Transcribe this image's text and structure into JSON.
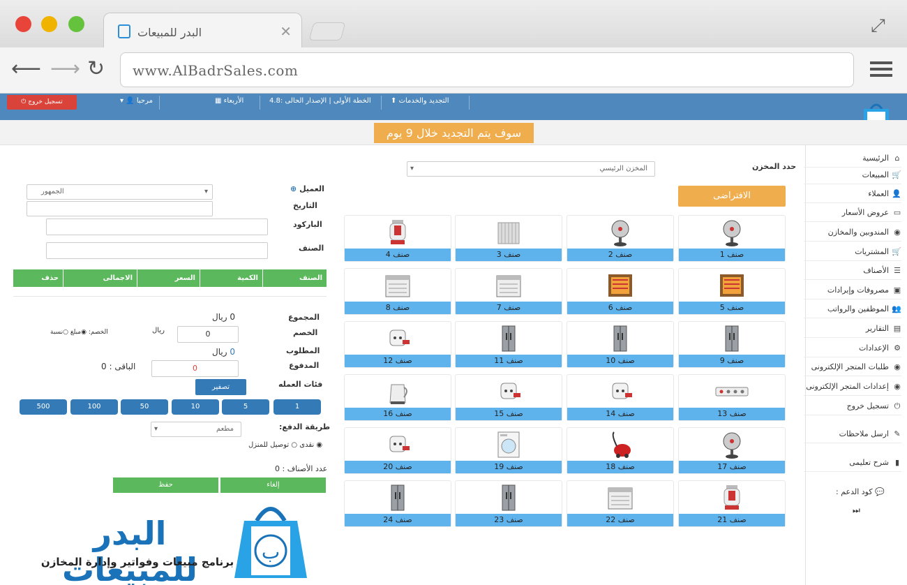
{
  "browser": {
    "tab_title": "البدر للمبيعات",
    "url": "www.AlBadrSales.com"
  },
  "header": {
    "logout": "تسجيل خروج",
    "welcome": "مرحبا",
    "day": "الأربعاء",
    "plan": "الخطة الأولى | الإصدار الحالى :4.8",
    "services": "التجديد والخدمات"
  },
  "banner": "سوف يتم التجديد خلال 9 يوم",
  "sidebar": [
    {
      "label": "الرئيسية",
      "icon": "home-icon",
      "glyph": "⌂"
    },
    {
      "label": "المبيعات",
      "icon": "cart-icon",
      "glyph": "🛒"
    },
    {
      "label": "العملاء",
      "icon": "user-icon",
      "glyph": "👤"
    },
    {
      "label": "عروض الأسعار",
      "icon": "card-icon",
      "glyph": "▭"
    },
    {
      "label": "المندوبين والمخازن",
      "icon": "globe-icon",
      "glyph": "◉"
    },
    {
      "label": "المشتريات",
      "icon": "cart-plus-icon",
      "glyph": "🛒"
    },
    {
      "label": "الأصناف",
      "icon": "list-icon",
      "glyph": "☰"
    },
    {
      "label": "مصروفات وإيرادات",
      "icon": "money-icon",
      "glyph": "▣"
    },
    {
      "label": "الموظفين والرواتب",
      "icon": "users-icon",
      "glyph": "👥"
    },
    {
      "label": "التقارير",
      "icon": "chart-icon",
      "glyph": "▤"
    },
    {
      "label": "الإعدادات",
      "icon": "gears-icon",
      "glyph": "⚙"
    },
    {
      "label": "طلبات المتجر الإلكترونى",
      "icon": "globe-icon",
      "glyph": "◉"
    },
    {
      "label": "إعدادات المتجر الإلكترونى",
      "icon": "globe-icon",
      "glyph": "◉"
    },
    {
      "label": "تسجيل خروج",
      "icon": "power-icon",
      "glyph": "⏻"
    },
    {
      "label": "ارسل ملاحظات",
      "icon": "pencil-icon",
      "glyph": "✎"
    },
    {
      "label": "شرح تعليمى",
      "icon": "book-icon",
      "glyph": "▮"
    }
  ],
  "support": {
    "label": "كود الدعم :",
    "skip": "⏭"
  },
  "warehouse": {
    "label": "حدد المخزن",
    "selected": "المخزن الرئيسي"
  },
  "default_button": "الافتراضى",
  "items": [
    {
      "label": "صنف 1",
      "icon": "fan-icon"
    },
    {
      "label": "صنف 2",
      "icon": "fan-icon"
    },
    {
      "label": "صنف 3",
      "icon": "radiator-icon"
    },
    {
      "label": "صنف 4",
      "icon": "heater-icon"
    },
    {
      "label": "صنف 5",
      "icon": "electric-heater-icon"
    },
    {
      "label": "صنف 6",
      "icon": "electric-heater-icon"
    },
    {
      "label": "صنف 7",
      "icon": "dishwasher-icon"
    },
    {
      "label": "صنف 8",
      "icon": "dishwasher-icon"
    },
    {
      "label": "صنف  9",
      "icon": "fridge-icon"
    },
    {
      "label": "صنف  10",
      "icon": "fridge-icon"
    },
    {
      "label": "صنف  11",
      "icon": "fridge-icon"
    },
    {
      "label": "صنف  12",
      "icon": "plug-icon"
    },
    {
      "label": "صنف  13",
      "icon": "power-strip-icon"
    },
    {
      "label": "صنف  14",
      "icon": "plug-icon"
    },
    {
      "label": "صنف  15",
      "icon": "plug-icon"
    },
    {
      "label": "صنف  16",
      "icon": "kettle-icon"
    },
    {
      "label": "صنف  17",
      "icon": "fan-icon"
    },
    {
      "label": "صنف  18",
      "icon": "vacuum-icon"
    },
    {
      "label": "صنف  19",
      "icon": "washer-icon"
    },
    {
      "label": "صنف  20",
      "icon": "plug-icon"
    },
    {
      "label": "صنف  21",
      "icon": "heater-icon"
    },
    {
      "label": "صنف  22",
      "icon": "dishwasher-icon"
    },
    {
      "label": "صنف  23",
      "icon": "fridge-icon"
    },
    {
      "label": "صنف  24",
      "icon": "fridge-icon"
    }
  ],
  "form": {
    "customer_label": "العميل",
    "customer_value": "الجمهور",
    "date_label": "التاريخ",
    "barcode_label": "الباركود",
    "item_label": "الصنف"
  },
  "table_headers": [
    "الصنف",
    "الكمية",
    "السعر",
    "الاجمالى",
    "حذف"
  ],
  "totals": {
    "total_label": "المجموع",
    "total_value": "0",
    "currency": "ريال",
    "discount_label": "الخصم",
    "discount_value": "0",
    "discount_currency": "ريال",
    "discount_type_label": "الخصم:",
    "discount_type_opt1": "مبلغ",
    "discount_type_opt2": "نسبة",
    "required_label": "المطلوب",
    "required_value": "0",
    "paid_label": "المدفوع",
    "paid_value": "0",
    "remaining": "الباقى : 0",
    "denoms_label": "فئات العمله",
    "reset": "تصفير"
  },
  "denominations": [
    "1",
    "5",
    "10",
    "50",
    "100",
    "500"
  ],
  "payment": {
    "label": "طريقة الدفع:",
    "selected": "مطعم",
    "cash": "نقدى",
    "delivery": "توصيل للمنزل",
    "count_label": "عدد الأصناف :",
    "count_value": "0"
  },
  "actions": {
    "cancel": "إلغاء",
    "save": "حفظ"
  },
  "brand": {
    "name": "البدر للمبيعات",
    "tagline": "برنامج مبيعات وفواتير وإدارة المخازن"
  },
  "colors": {
    "appbar": "#4f88bd",
    "orange": "#f0ad4e",
    "green": "#5cb85c",
    "blue": "#337ab7",
    "item_footer": "#5fb3ec",
    "brand_blue": "#1a73b8"
  }
}
